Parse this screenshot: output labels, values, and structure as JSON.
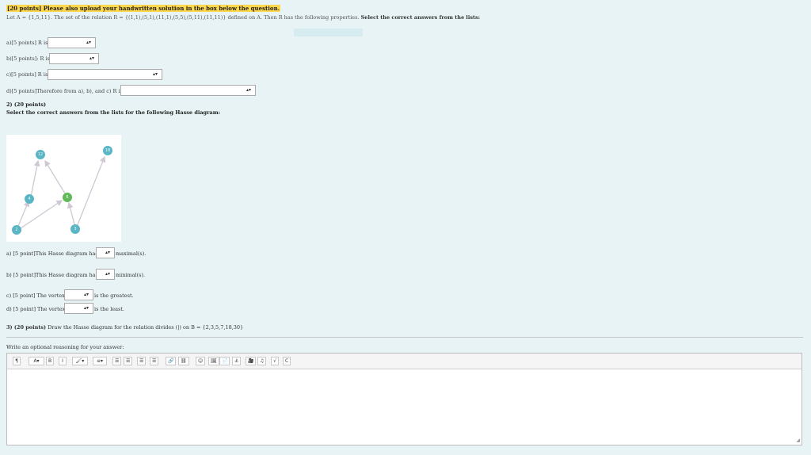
{
  "header": {
    "highlight": "[20 points] Please also upload your handwritten solution in the box below the question."
  },
  "question": {
    "prefix": "Let A = {1,5,11}. The set of the relation R = {(1,1),(5,1),(11,1),(5,5),(5,11),(11,11)} defined on A. Then R has the following properties.",
    "bold": "Select the correct answers from the lists:"
  },
  "faint_tab": "",
  "part1": {
    "a_label": "a)[5 points] R is",
    "b_label": "b)[5 points]: R is",
    "c_label": "c)[5 points] R is",
    "d_label": "d)[5 points]Therefore from a), b), and c) R is"
  },
  "part2": {
    "title": "2) (20 points)",
    "subtitle": "Select the correct answers from the lists for the following Hasse diagram:",
    "nodes": [
      {
        "label": "18",
        "highlight": false
      },
      {
        "label": "12",
        "highlight": false
      },
      {
        "label": "4",
        "highlight": false
      },
      {
        "label": "6",
        "highlight": true
      },
      {
        "label": "2",
        "highlight": false
      },
      {
        "label": "3",
        "highlight": false
      }
    ],
    "a_prefix": "a) [5 point]This Hasse diagram has",
    "a_suffix": "maximal(s).",
    "b_prefix": "b) [5 point]This Hasse diagram has",
    "b_suffix": "minimal(s).",
    "c_prefix": "c) [5 point] The vertex",
    "c_suffix": "is the greatest.",
    "d_prefix": "d) [5 point] The vertex",
    "d_suffix": "is the least."
  },
  "part3": {
    "title": "3) (20 points)",
    "text": "Draw the Hasse diagram for the relation divides (|) on B = {2,3,5,7,18,30}"
  },
  "editor": {
    "prompt": "Write an optional reasoning for your answer:",
    "toolbar": [
      "¶",
      "A▾",
      "B",
      "I",
      "🖌▾",
      "≡▾",
      "☰",
      "☰",
      "☰",
      "☰",
      "🔗",
      "⛓",
      "☺",
      "🖼",
      "📄",
      "⚓",
      "🎥",
      "♫",
      "√",
      "C"
    ]
  },
  "colors": {
    "background": "#e7f3f5",
    "highlight": "#ffd84d",
    "node": "#5ab5c5",
    "node_highlight": "#61b95a"
  }
}
